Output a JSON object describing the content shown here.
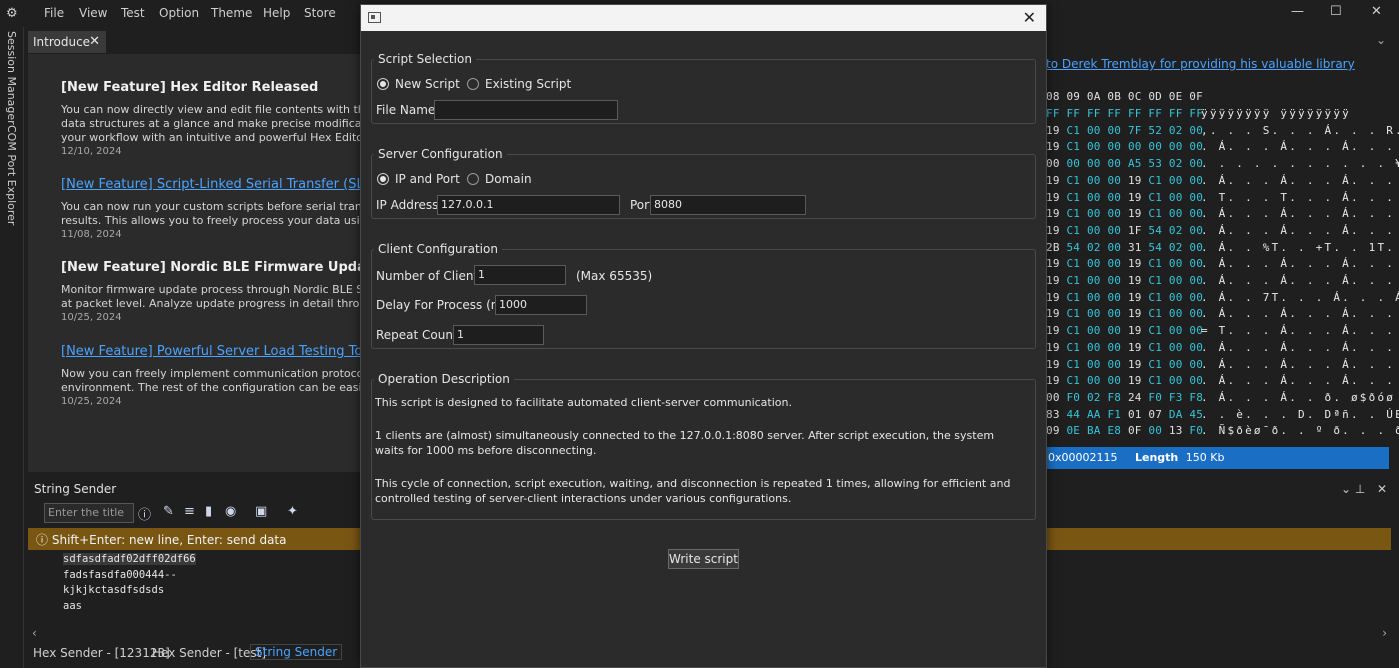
{
  "menu": [
    "File",
    "View",
    "Test",
    "Option",
    "Theme",
    "Help",
    "Store"
  ],
  "window_controls": {
    "minimize": "—",
    "maximize": "☐",
    "close": "✕"
  },
  "rail": {
    "session_manager": "Session Manager",
    "com_port_explorer": "COM Port Explorer"
  },
  "doc_tab": {
    "label": "Introduce",
    "close": "✕"
  },
  "news": [
    {
      "title": "[New Feature] Hex Editor Released",
      "is_link": false,
      "body": [
        "You can now directly view and edit file contents with the Hex",
        "data structures at a glance and make precise modifications wi",
        "your workflow with an intuitive and powerful Hex Editor!"
      ],
      "date": "12/10, 2024"
    },
    {
      "title": "[New Feature] Script-Linked Serial Transfer (SLST)",
      "is_link": true,
      "body": [
        "You can now run your custom scripts before serial transmissic",
        "results. This allows you to freely process your data using scrip"
      ],
      "date": "11/08, 2024"
    },
    {
      "title": "[New Feature] Nordic BLE Firmware Update Monito",
      "is_link": false,
      "body": [
        "Monitor firmware update process through Nordic BLE Secure",
        "at packet level. Analyze update progress in detail through UA"
      ],
      "date": "10/25, 2024"
    },
    {
      "title": "[New Feature] Powerful Server Load Testing Tool Re",
      "is_link": true,
      "body": [
        "Now you can freely implement communication protocols with",
        "environment. The rest of the configuration can be easily done"
      ],
      "date": "10/25, 2024"
    }
  ],
  "string_sender": {
    "title": "String Sender",
    "title_placeholder": "Enter the title",
    "hint": "Shift+Enter: new line, Enter: send data",
    "lines": [
      "sdfasdfadf02dff02df66",
      "fadsfasdfa000444--",
      "kjkjkctasdfsdsds",
      "aas"
    ]
  },
  "bottom_tabs": [
    {
      "label": "Hex Sender - [123123]",
      "active": false
    },
    {
      "label": "Hex Sender - [test]",
      "active": false
    },
    {
      "label": "String Sender",
      "active": true
    }
  ],
  "hex_panel": {
    "link": "to Derek Tremblay for providing his valuable library",
    "header": "08 09 0A 0B 0C 0D 0E 0F",
    "rows": [
      {
        "bytes": [
          "FF",
          "FF",
          "FF",
          "FF",
          "FF",
          "FF",
          "FF",
          "FF"
        ],
        "ascii": "ÿÿÿÿÿÿÿÿ ÿÿÿÿÿÿÿÿ"
      },
      {
        "bytes": [
          "19",
          "C1",
          "00",
          "00",
          "7F",
          "52",
          "02",
          "00"
        ],
        "ascii": ",. . . S. . . Á. . . R."
      },
      {
        "bytes": [
          "19",
          "C1",
          "00",
          "00",
          "00",
          "00",
          "00",
          "00"
        ],
        "ascii": ". Á. . . Á. . . Á. . . ."
      },
      {
        "bytes": [
          "00",
          "00",
          "00",
          "00",
          "A5",
          "53",
          "02",
          "00"
        ],
        "ascii": ". . . . . . . . . . . ¥S. ."
      },
      {
        "bytes": [
          "19",
          "C1",
          "00",
          "00",
          "19",
          "C1",
          "00",
          "00"
        ],
        "ascii": ". Á. . . Á. . . Á. . . Á. ."
      },
      {
        "bytes": [
          "19",
          "C1",
          "00",
          "00",
          "19",
          "C1",
          "00",
          "00"
        ],
        "ascii": ". T. . . T. . . Á. . . Á. ."
      },
      {
        "bytes": [
          "19",
          "C1",
          "00",
          "00",
          "19",
          "C1",
          "00",
          "00"
        ],
        "ascii": ". Á. . . Á. . . Á. . . Á. ."
      },
      {
        "bytes": [
          "19",
          "C1",
          "00",
          "00",
          "1F",
          "54",
          "02",
          "00"
        ],
        "ascii": ". Á. . . Á. . . Á. . . T. ."
      },
      {
        "bytes": [
          "2B",
          "54",
          "02",
          "00",
          "31",
          "54",
          "02",
          "00"
        ],
        "ascii": ". Á. . %T. . +T. . 1T. ."
      },
      {
        "bytes": [
          "19",
          "C1",
          "00",
          "00",
          "19",
          "C1",
          "00",
          "00"
        ],
        "ascii": ". Á. . . Á. . . Á. . . Á. ."
      },
      {
        "bytes": [
          "19",
          "C1",
          "00",
          "00",
          "19",
          "C1",
          "00",
          "00"
        ],
        "ascii": ". Á. . . Á. . . Á. . . Á. ."
      },
      {
        "bytes": [
          "19",
          "C1",
          "00",
          "00",
          "19",
          "C1",
          "00",
          "00"
        ],
        "ascii": ". Á. . 7T. . . Á. . . Á. ."
      },
      {
        "bytes": [
          "19",
          "C1",
          "00",
          "00",
          "19",
          "C1",
          "00",
          "00"
        ],
        "ascii": ". Á. . . Á. . . Á. . . Á. ."
      },
      {
        "bytes": [
          "19",
          "C1",
          "00",
          "00",
          "19",
          "C1",
          "00",
          "00"
        ],
        "ascii": "= T. . . Á. . . Á. . . Á. ."
      },
      {
        "bytes": [
          "19",
          "C1",
          "00",
          "00",
          "19",
          "C1",
          "00",
          "00"
        ],
        "ascii": ". Á. . . Á. . . Á. . . Á. ."
      },
      {
        "bytes": [
          "19",
          "C1",
          "00",
          "00",
          "19",
          "C1",
          "00",
          "00"
        ],
        "ascii": ". Á. . . Á. . . Á. . . Á. ."
      },
      {
        "bytes": [
          "19",
          "C1",
          "00",
          "00",
          "19",
          "C1",
          "00",
          "00"
        ],
        "ascii": ". Á. . . Á. . . Á. . . Á. ."
      },
      {
        "bytes": [
          "00",
          "F0",
          "02",
          "F8",
          "24",
          "F0",
          "F3",
          "F8"
        ],
        "ascii": ". Á. . . Á. . ð. ø$ðóø"
      },
      {
        "bytes": [
          "83",
          "44",
          "AA",
          "F1",
          "01",
          "07",
          "DA",
          "45"
        ],
        "ascii": ". . è. . . D. Dªñ. . ÚE"
      },
      {
        "bytes": [
          "09",
          "0E",
          "BA",
          "E8",
          "0F",
          "00",
          "13",
          "F0"
        ],
        "ascii": ". Ñ$ðèø¯ð. . º ð. . . ð"
      }
    ],
    "status_offset": "0x00002115",
    "status_length_label": "Length",
    "status_length_value": "150 Kb"
  },
  "dialog": {
    "script_selection": {
      "legend": "Script Selection",
      "new_script": "New Script",
      "existing_script": "Existing Script",
      "file_name_label": "File Name",
      "file_name_value": ""
    },
    "server_configuration": {
      "legend": "Server Configuration",
      "ip_and_port": "IP and Port",
      "domain": "Domain",
      "ip_label": "IP Address",
      "ip_value": "127.0.0.1",
      "port_label": "Port",
      "port_value": "8080"
    },
    "client_configuration": {
      "legend": "Client Configuration",
      "num_clients_label": "Number of Clients",
      "num_clients_value": "1",
      "max_note": "(Max 65535)",
      "delay_label": "Delay For Process (ms)",
      "delay_value": "1000",
      "repeat_label": "Repeat Count",
      "repeat_value": "1"
    },
    "operation_description": {
      "legend": "Operation Description",
      "p1": "This script is designed to facilitate automated client-server communication.",
      "p2": "1 clients are (almost) simultaneously connected to the 127.0.0.1:8080 server. After script execution, the system waits for 1000 ms before disconnecting.",
      "p3": "This cycle of connection, script execution, waiting, and disconnection is repeated 1 times, allowing for efficient and controlled testing of server-client interactions under various configurations."
    },
    "write_button": "Write script",
    "close": "✕"
  },
  "colors": {
    "accent": "#4aa3ff",
    "cyan": "#35c4d8",
    "hint_bar": "#7a5613",
    "status_bar": "#1a6fc4"
  }
}
